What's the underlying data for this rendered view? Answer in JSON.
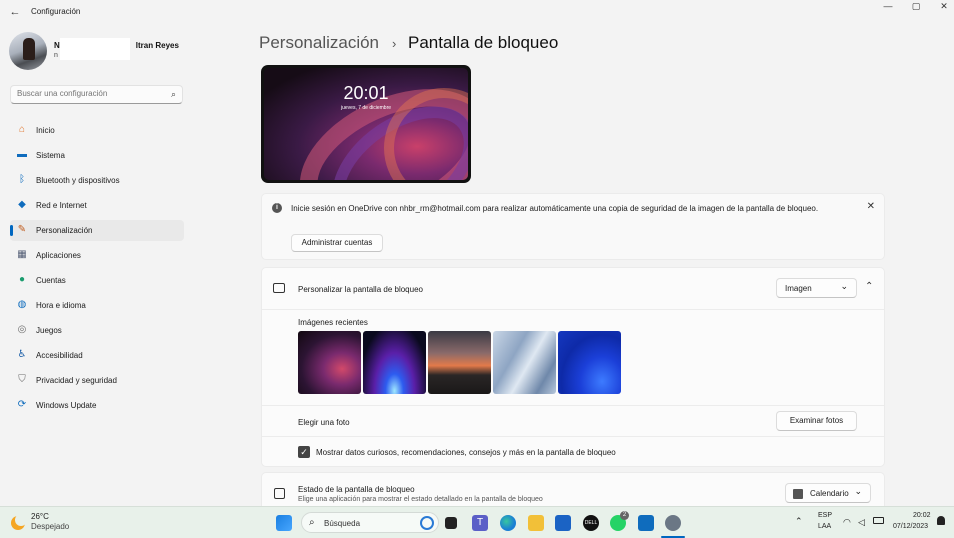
{
  "window": {
    "title": "Configuración",
    "back_glyph": "←",
    "minimize": "—",
    "maximize": "▢",
    "close": "✕"
  },
  "user": {
    "name_start": "N",
    "name_end": "ltran Reyes",
    "email_start": "n"
  },
  "search": {
    "placeholder": "Buscar una configuración",
    "icon": "search-icon"
  },
  "nav": [
    {
      "label": "Inicio",
      "icon": "home-icon",
      "glyph": "⌂",
      "color": "#e0752b"
    },
    {
      "label": "Sistema",
      "icon": "system-icon",
      "glyph": "▬",
      "color": "#0f6cbd"
    },
    {
      "label": "Bluetooth y dispositivos",
      "icon": "bluetooth-icon",
      "glyph": "ᛒ",
      "color": "#0f6cbd"
    },
    {
      "label": "Red e Internet",
      "icon": "network-icon",
      "glyph": "◆",
      "color": "#0f6cbd"
    },
    {
      "label": "Personalización",
      "icon": "brush-icon",
      "glyph": "✎",
      "color": "#c05a1a"
    },
    {
      "label": "Aplicaciones",
      "icon": "apps-icon",
      "glyph": "▦",
      "color": "#505b73"
    },
    {
      "label": "Cuentas",
      "icon": "accounts-icon",
      "glyph": "●",
      "color": "#1a9c6e"
    },
    {
      "label": "Hora e idioma",
      "icon": "globe-clock-icon",
      "glyph": "◍",
      "color": "#0f6cbd"
    },
    {
      "label": "Juegos",
      "icon": "gamepad-icon",
      "glyph": "◎",
      "color": "#6b6b6b"
    },
    {
      "label": "Accesibilidad",
      "icon": "accessibility-icon",
      "glyph": "♿",
      "color": "#1b5fa8"
    },
    {
      "label": "Privacidad y seguridad",
      "icon": "shield-icon",
      "glyph": "⛉",
      "color": "#6b6b6b"
    },
    {
      "label": "Windows Update",
      "icon": "update-icon",
      "glyph": "⟳",
      "color": "#0f6cbd"
    }
  ],
  "breadcrumb": {
    "parent": "Personalización",
    "separator": "›",
    "current": "Pantalla de bloqueo"
  },
  "preview": {
    "time": "20:01",
    "date": "jueves, 7 de diciembre"
  },
  "info_bar": {
    "icon_glyph": "i",
    "text": "Inicie sesión en OneDrive con nhbr_rm@hotmail.com para realizar automáticamente una copia de seguridad de la imagen de la pantalla de bloqueo.",
    "button": "Administrar cuentas",
    "close_glyph": "✕"
  },
  "personalize": {
    "title": "Personalizar la pantalla de bloqueo",
    "dropdown_value": "Imagen",
    "chevron_down": "⌄",
    "chevron_up": "⌃",
    "recent_label": "Imágenes recientes",
    "choose_label": "Elegir una foto",
    "browse_button": "Examinar fotos",
    "checkbox_label": "Mostrar datos curiosos, recomendaciones, consejos y más en la pantalla de bloqueo",
    "checkbox_checked": true,
    "checkbox_glyph": "✓"
  },
  "status": {
    "title": "Estado de la pantalla de bloqueo",
    "subtitle": "Elige una aplicación para mostrar el estado detallado en la pantalla de bloqueo",
    "dropdown_value": "Calendario",
    "chevron_down": "⌄"
  },
  "taskbar": {
    "weather_temp": "26°C",
    "weather_desc": "Despejado",
    "search_label": "Búsqueda",
    "search_glyph": "⌕",
    "language_top": "ESP",
    "language_bottom": "LAA",
    "clock_time": "20:02",
    "clock_date": "07/12/2023",
    "tray_chevron": "⌃",
    "whatsapp_badge": "2",
    "notification_glyph": "🔔"
  },
  "colors": {
    "accent": "#0067c0",
    "taskbar_bg": "#e8f1ea",
    "window_bg": "#f3f3f3"
  }
}
